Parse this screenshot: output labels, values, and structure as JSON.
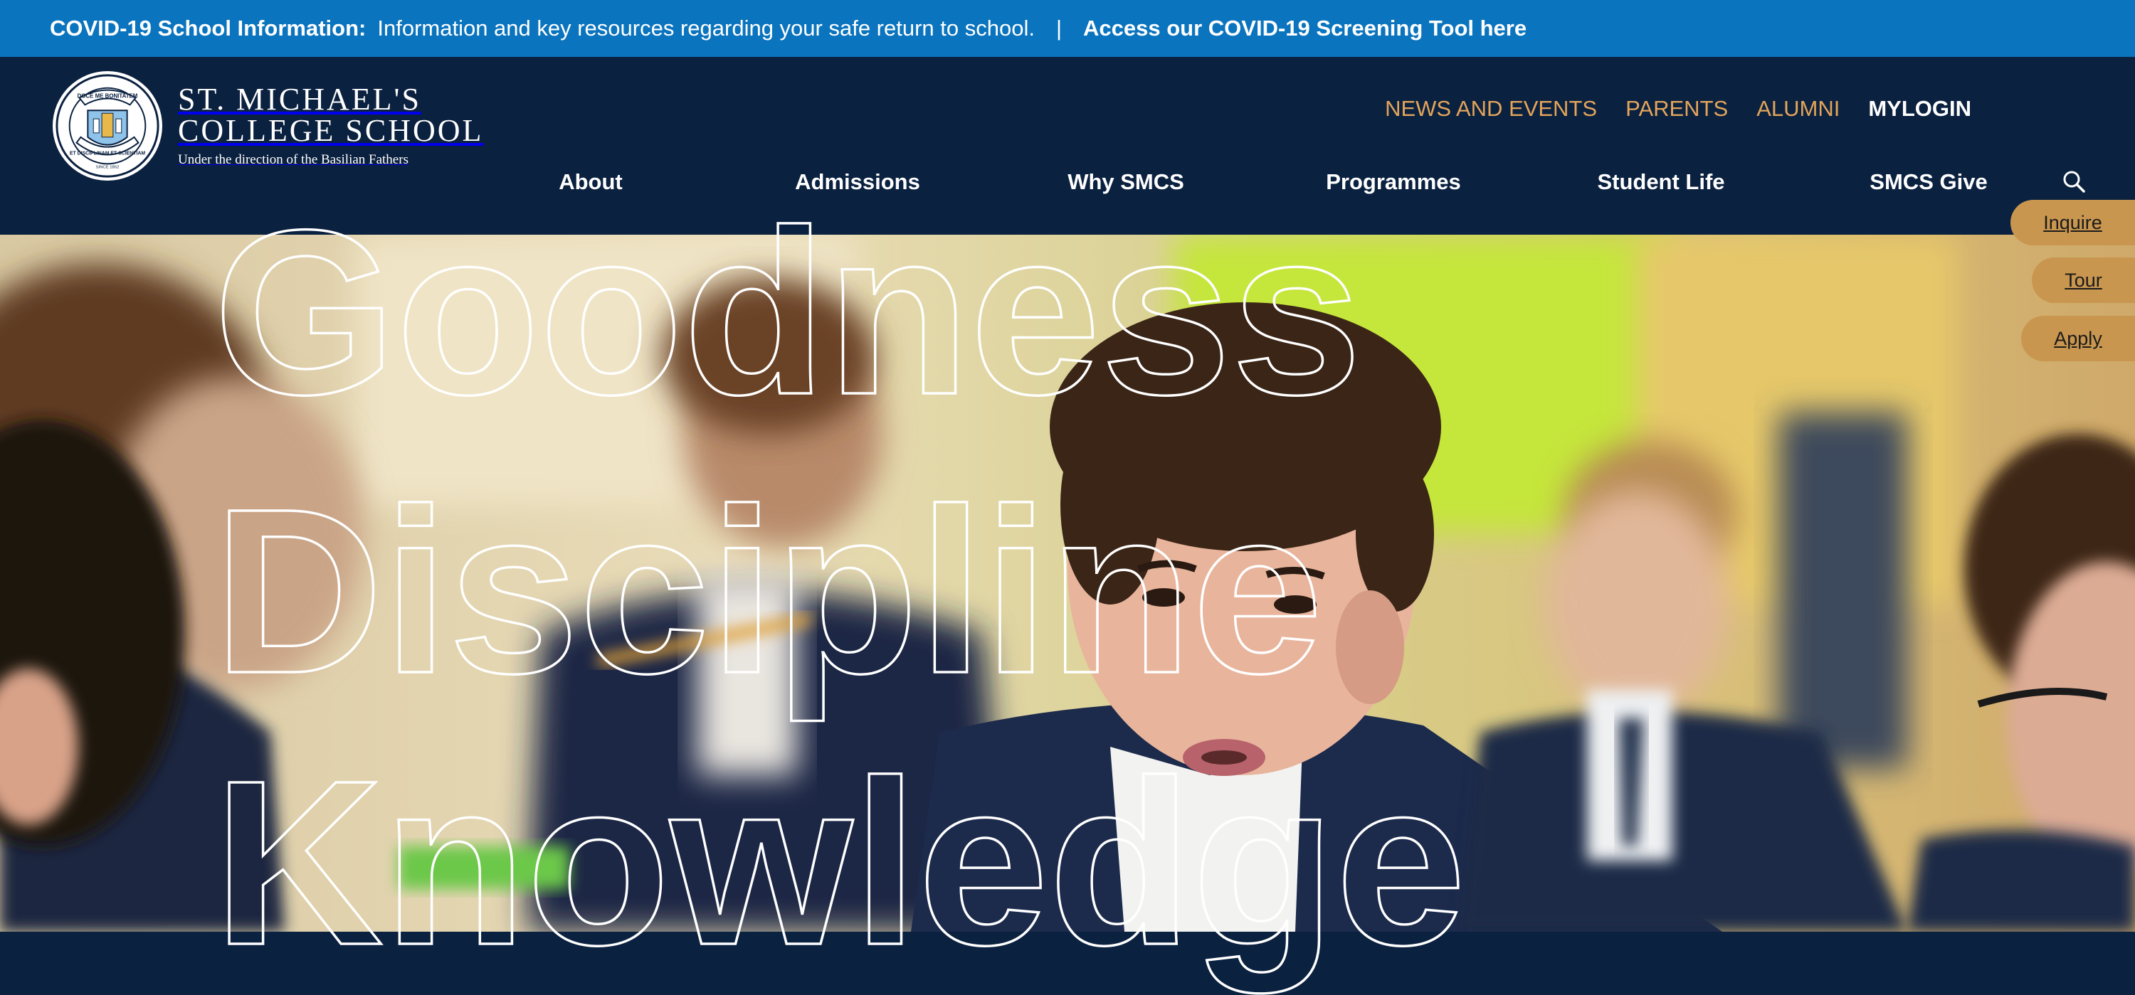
{
  "alert": {
    "title": "COVID-19 School Information:",
    "message": "Information and key resources regarding your safe return to school.",
    "separator": "|",
    "link": "Access our COVID-19 Screening Tool here"
  },
  "logo": {
    "line1": "ST. MICHAEL'S",
    "line2": "COLLEGE SCHOOL",
    "tagline": "Under the direction of the Basilian Fathers",
    "crest_top": "DOCE ME BONITATEM",
    "crest_bottom": "ET DISCIPLINAM ET SCIENTIAM",
    "crest_since": "SINCE 1852"
  },
  "util_nav": [
    "NEWS AND EVENTS",
    "PARENTS",
    "ALUMNI",
    "MYLOGIN"
  ],
  "main_nav": [
    "About",
    "Admissions",
    "Why SMCS",
    "Programmes",
    "Student Life",
    "SMCS Give"
  ],
  "hero": {
    "word1": "Goodness",
    "word2": "Discipline",
    "word3": "Knowledge"
  },
  "side_tabs": [
    "Inquire",
    "Tour",
    "Apply"
  ],
  "icons": {
    "search": "search-icon"
  },
  "colors": {
    "alert_bg": "#0b74be",
    "navy": "#0b2140",
    "gold": "#e3a55a",
    "tab": "#c9964f"
  }
}
